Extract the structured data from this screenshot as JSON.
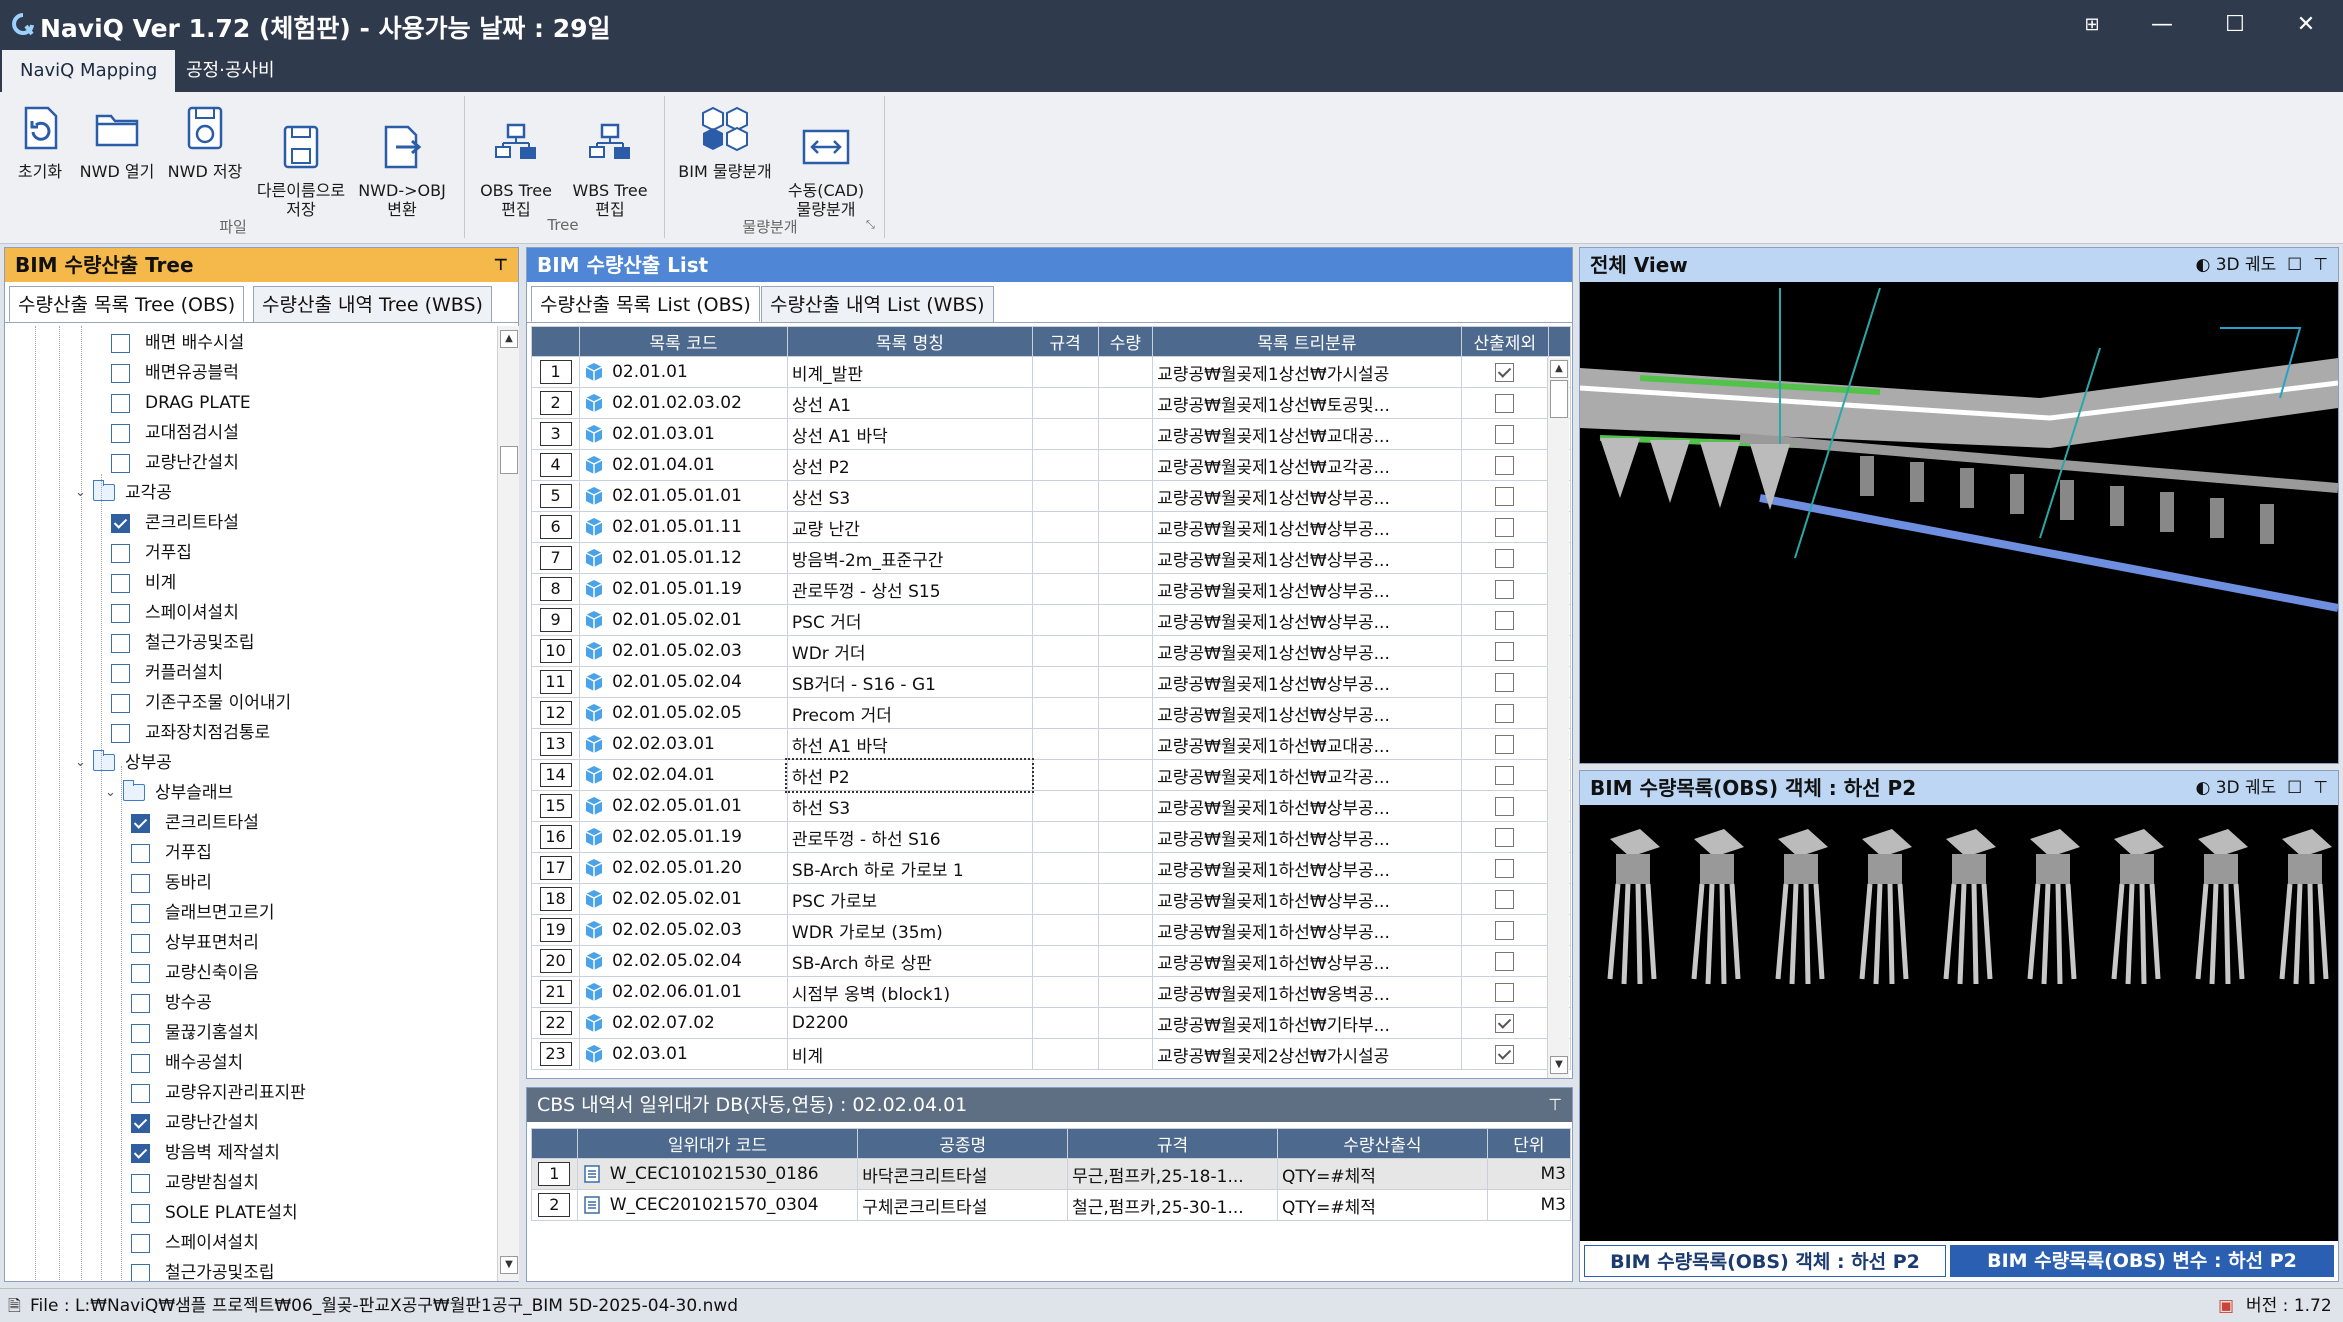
{
  "titlebar": {
    "title": "NaviQ Ver 1.72 (체험판) - 사용가능 날짜 : 29일",
    "buttons": [
      "⊞",
      "—",
      "☐",
      "✕"
    ]
  },
  "ribbon_tabs": [
    {
      "label": "NaviQ Mapping",
      "active": true
    },
    {
      "label": "공정·공사비",
      "active": false
    }
  ],
  "ribbon": {
    "buttons": [
      {
        "label": "초기화",
        "icon": "reset-icon"
      },
      {
        "label": "NWD 열기",
        "icon": "folder-open-icon"
      },
      {
        "label": "NWD 저장",
        "icon": "save-sync-icon"
      },
      {
        "label": "다른이름으로\n저장",
        "icon": "save-as-icon"
      },
      {
        "label": "NWD->OBJ\n변환",
        "icon": "convert-icon"
      },
      {
        "label": "OBS Tree\n편집",
        "icon": "obs-tree-icon"
      },
      {
        "label": "WBS Tree\n편집",
        "icon": "wbs-tree-icon"
      },
      {
        "label": "BIM 물량분개",
        "icon": "bim-split-icon"
      },
      {
        "label": "수동(CAD)\n물량분개",
        "icon": "cad-split-icon"
      }
    ],
    "groups": [
      "파일",
      "Tree",
      "물량분개"
    ]
  },
  "tree_panel": {
    "title": "BIM 수량산출 Tree",
    "tabs": [
      {
        "label": "수량산출 목록 Tree (OBS)",
        "active": true
      },
      {
        "label": "수량산출 내역 Tree (WBS)",
        "active": false
      }
    ],
    "items": [
      {
        "label": "배면 배수시설",
        "checked": false,
        "level": 3
      },
      {
        "label": "배면유공블럭",
        "checked": false,
        "level": 3
      },
      {
        "label": "DRAG PLATE",
        "checked": false,
        "level": 3
      },
      {
        "label": "교대점검시설",
        "checked": false,
        "level": 3
      },
      {
        "label": "교량난간설치",
        "checked": false,
        "level": 3
      },
      {
        "label": "교각공",
        "folder": true,
        "level": 2
      },
      {
        "label": "콘크리트타설",
        "checked": true,
        "level": 3
      },
      {
        "label": "거푸집",
        "checked": false,
        "level": 3
      },
      {
        "label": "비계",
        "checked": false,
        "level": 3
      },
      {
        "label": "스페이셔설치",
        "checked": false,
        "level": 3
      },
      {
        "label": "철근가공및조립",
        "checked": false,
        "level": 3
      },
      {
        "label": "커플러설치",
        "checked": false,
        "level": 3
      },
      {
        "label": "기존구조물 이어내기",
        "checked": false,
        "level": 3
      },
      {
        "label": "교좌장치점검통로",
        "checked": false,
        "level": 3
      },
      {
        "label": "상부공",
        "folder": true,
        "level": 2
      },
      {
        "label": "상부슬래브",
        "folder": true,
        "level": 3
      },
      {
        "label": "콘크리트타설",
        "checked": true,
        "level": 4
      },
      {
        "label": "거푸집",
        "checked": false,
        "level": 4
      },
      {
        "label": "동바리",
        "checked": false,
        "level": 4
      },
      {
        "label": "슬래브면고르기",
        "checked": false,
        "level": 4
      },
      {
        "label": "상부표면처리",
        "checked": false,
        "level": 4
      },
      {
        "label": "교량신축이음",
        "checked": false,
        "level": 4
      },
      {
        "label": "방수공",
        "checked": false,
        "level": 4
      },
      {
        "label": "물끊기홈설치",
        "checked": false,
        "level": 4
      },
      {
        "label": "배수공설치",
        "checked": false,
        "level": 4
      },
      {
        "label": "교량유지관리표지판",
        "checked": false,
        "level": 4
      },
      {
        "label": "교량난간설치",
        "checked": true,
        "level": 4
      },
      {
        "label": "방음벽 제작설치",
        "checked": true,
        "level": 4
      },
      {
        "label": "교량받침설치",
        "checked": false,
        "level": 4
      },
      {
        "label": "SOLE PLATE설치",
        "checked": false,
        "level": 4
      },
      {
        "label": "스페이셔설치",
        "checked": false,
        "level": 4
      },
      {
        "label": "철근가공및조립",
        "checked": false,
        "level": 4
      }
    ]
  },
  "list_panel": {
    "title": "BIM 수량산출 List",
    "tabs": [
      {
        "label": "수량산출 목록 List (OBS)",
        "active": true
      },
      {
        "label": "수량산출 내역 List (WBS)",
        "active": false
      }
    ],
    "columns": [
      "목록 코드",
      "목록 명칭",
      "규격",
      "수량",
      "목록 트리분류",
      "산출제외"
    ],
    "rows": [
      {
        "n": "1",
        "code": "02.01.01",
        "name": "비계_발판",
        "spec": "",
        "qty": "",
        "cat": "교량공₩월곶제1상선₩가시설공",
        "excl": true
      },
      {
        "n": "2",
        "code": "02.01.02.03.02",
        "name": "상선 A1",
        "spec": "",
        "qty": "",
        "cat": "교량공₩월곶제1상선₩토공및...",
        "excl": false
      },
      {
        "n": "3",
        "code": "02.01.03.01",
        "name": "상선 A1 바닥",
        "spec": "",
        "qty": "",
        "cat": "교량공₩월곶제1상선₩교대공...",
        "excl": false
      },
      {
        "n": "4",
        "code": "02.01.04.01",
        "name": "상선 P2",
        "spec": "",
        "qty": "",
        "cat": "교량공₩월곶제1상선₩교각공...",
        "excl": false
      },
      {
        "n": "5",
        "code": "02.01.05.01.01",
        "name": "상선 S3",
        "spec": "",
        "qty": "",
        "cat": "교량공₩월곶제1상선₩상부공...",
        "excl": false
      },
      {
        "n": "6",
        "code": "02.01.05.01.11",
        "name": "교량 난간",
        "spec": "",
        "qty": "",
        "cat": "교량공₩월곶제1상선₩상부공...",
        "excl": false
      },
      {
        "n": "7",
        "code": "02.01.05.01.12",
        "name": "방음벽-2m_표준구간",
        "spec": "",
        "qty": "",
        "cat": "교량공₩월곶제1상선₩상부공...",
        "excl": false
      },
      {
        "n": "8",
        "code": "02.01.05.01.19",
        "name": "관로뚜껑 - 상선 S15",
        "spec": "",
        "qty": "",
        "cat": "교량공₩월곶제1상선₩상부공...",
        "excl": false
      },
      {
        "n": "9",
        "code": "02.01.05.02.01",
        "name": "PSC 거더",
        "spec": "",
        "qty": "",
        "cat": "교량공₩월곶제1상선₩상부공...",
        "excl": false
      },
      {
        "n": "10",
        "code": "02.01.05.02.03",
        "name": "WDr 거더",
        "spec": "",
        "qty": "",
        "cat": "교량공₩월곶제1상선₩상부공...",
        "excl": false
      },
      {
        "n": "11",
        "code": "02.01.05.02.04",
        "name": "SB거더 - S16 - G1",
        "spec": "",
        "qty": "",
        "cat": "교량공₩월곶제1상선₩상부공...",
        "excl": false
      },
      {
        "n": "12",
        "code": "02.01.05.02.05",
        "name": "Precom 거더",
        "spec": "",
        "qty": "",
        "cat": "교량공₩월곶제1상선₩상부공...",
        "excl": false
      },
      {
        "n": "13",
        "code": "02.02.03.01",
        "name": "하선 A1 바닥",
        "spec": "",
        "qty": "",
        "cat": "교량공₩월곶제1하선₩교대공...",
        "excl": false
      },
      {
        "n": "14",
        "code": "02.02.04.01",
        "name": "하선 P2",
        "spec": "",
        "qty": "",
        "cat": "교량공₩월곶제1하선₩교각공...",
        "excl": false,
        "selected": true
      },
      {
        "n": "15",
        "code": "02.02.05.01.01",
        "name": "하선 S3",
        "spec": "",
        "qty": "",
        "cat": "교량공₩월곶제1하선₩상부공...",
        "excl": false
      },
      {
        "n": "16",
        "code": "02.02.05.01.19",
        "name": "관로뚜껑 - 하선 S16",
        "spec": "",
        "qty": "",
        "cat": "교량공₩월곶제1하선₩상부공...",
        "excl": false
      },
      {
        "n": "17",
        "code": "02.02.05.01.20",
        "name": "SB-Arch 하로 가로보 1",
        "spec": "",
        "qty": "",
        "cat": "교량공₩월곶제1하선₩상부공...",
        "excl": false
      },
      {
        "n": "18",
        "code": "02.02.05.02.01",
        "name": "PSC 가로보",
        "spec": "",
        "qty": "",
        "cat": "교량공₩월곶제1하선₩상부공...",
        "excl": false
      },
      {
        "n": "19",
        "code": "02.02.05.02.03",
        "name": "WDR 가로보 (35m)",
        "spec": "",
        "qty": "",
        "cat": "교량공₩월곶제1하선₩상부공...",
        "excl": false
      },
      {
        "n": "20",
        "code": "02.02.05.02.04",
        "name": "SB-Arch 하로 상판",
        "spec": "",
        "qty": "",
        "cat": "교량공₩월곶제1하선₩상부공...",
        "excl": false
      },
      {
        "n": "21",
        "code": "02.02.06.01.01",
        "name": "시점부 옹벽 (block1)",
        "spec": "",
        "qty": "",
        "cat": "교량공₩월곶제1하선₩옹벽공...",
        "excl": false
      },
      {
        "n": "22",
        "code": "02.02.07.02",
        "name": "D2200",
        "spec": "",
        "qty": "",
        "cat": "교량공₩월곶제1하선₩기타부...",
        "excl": true
      },
      {
        "n": "23",
        "code": "02.03.01",
        "name": "비계",
        "spec": "",
        "qty": "",
        "cat": "교량공₩월곶제2상선₩가시설공",
        "excl": true
      }
    ]
  },
  "cbs_panel": {
    "title": "CBS 내역서 일위대가 DB(자동,연동) : 02.02.04.01",
    "columns": [
      "일위대가 코드",
      "공종명",
      "규격",
      "수량산출식",
      "단위"
    ],
    "rows": [
      {
        "n": "1",
        "code": "W_CEC101021530_0186",
        "name": "바닥콘크리트타설",
        "spec": "무근,펌프카,25-18-1...",
        "formula": "QTY=#체적",
        "unit": "M3"
      },
      {
        "n": "2",
        "code": "W_CEC201021570_0304",
        "name": "구체콘크리트타설",
        "spec": "철근,펌프카,25-30-1...",
        "formula": "QTY=#체적",
        "unit": "M3"
      }
    ]
  },
  "view_top": {
    "title": "전체 View",
    "tool": "3D 궤도"
  },
  "view_bottom": {
    "title": "BIM 수량목록(OBS) 객체 : 하선 P2",
    "tool": "3D 궤도"
  },
  "view_tabs": [
    {
      "label": "BIM 수량목록(OBS) 객체 : 하선 P2",
      "active": true
    },
    {
      "label": "BIM 수량목록(OBS) 변수 : 하선 P2",
      "active": false
    }
  ],
  "status": {
    "file": "File : L:₩NaviQ₩샘플 프로젝트₩06_월곶-판교X공구₩월판1공구_BIM 5D-2025-04-30.nwd",
    "version": "버전 : 1.72"
  },
  "colors": {
    "titlebar": "#2f3a4c",
    "tree_header": "#f4b94a",
    "list_header": "#4f86d6",
    "grid_header": "#4d6a8e",
    "view_header": "#bcd6f3",
    "view_tab_active": "#2a5fb2"
  }
}
